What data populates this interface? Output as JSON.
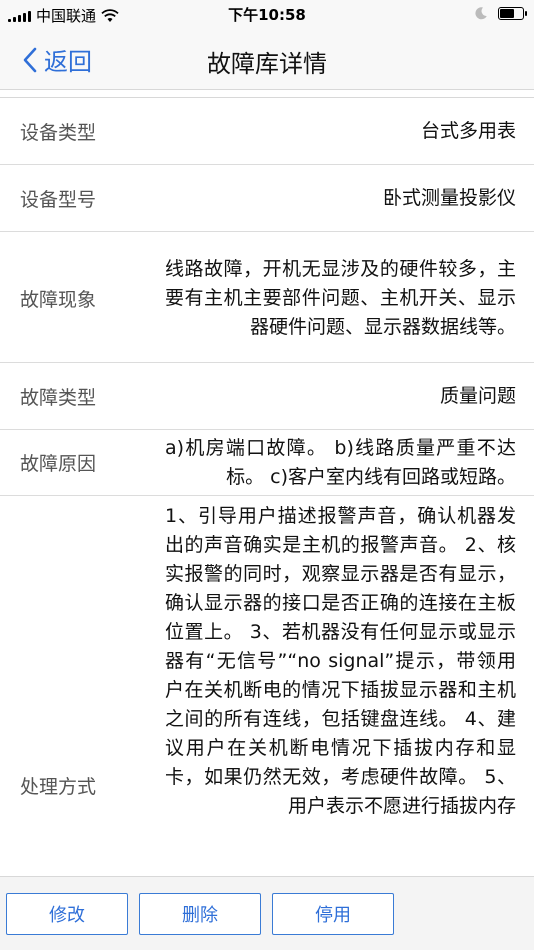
{
  "status_bar": {
    "carrier": "中国联通",
    "time": "下午10:58"
  },
  "nav": {
    "back_label": "返回",
    "title": "故障库详情"
  },
  "details": [
    {
      "label": "设备类型",
      "value": "台式多用表"
    },
    {
      "label": "设备型号",
      "value": "卧式测量投影仪"
    },
    {
      "label": "故障现象",
      "value": "线路故障，开机无显涉及的硬件较多，主要有主机主要部件问题、主机开关、显示器硬件问题、显示器数据线等。"
    },
    {
      "label": "故障类型",
      "value": "质量问题"
    },
    {
      "label": "故障原因",
      "value": "a)机房端口故障。 b)线路质量严重不达标。 c)客户室内线有回路或短路。"
    },
    {
      "label": "处理方式",
      "value": "1、引导用户描述报警声音，确认机器发出的声音确实是主机的报警声音。 2、核实报警的同时，观察显示器是否有显示，确认显示器的接口是否正确的连接在主板位置上。 3、若机器没有任何显示或显示器有“无信号”“no signal”提示，带领用户在关机断电的情况下插拔显示器和主机之间的所有连线，包括键盘连线。 4、建议用户在关机断电情况下插拔内存和显卡，如果仍然无效，考虑硬件故障。 5、用户表示不愿进行插拔内存"
    }
  ],
  "actions": {
    "edit_label": "修改",
    "delete_label": "删除",
    "disable_label": "停用"
  },
  "colors": {
    "accent": "#2f6fd8",
    "button_border": "#3a7bd5",
    "divider": "#dcdcdc",
    "bar_background": "#f8f8f8"
  }
}
